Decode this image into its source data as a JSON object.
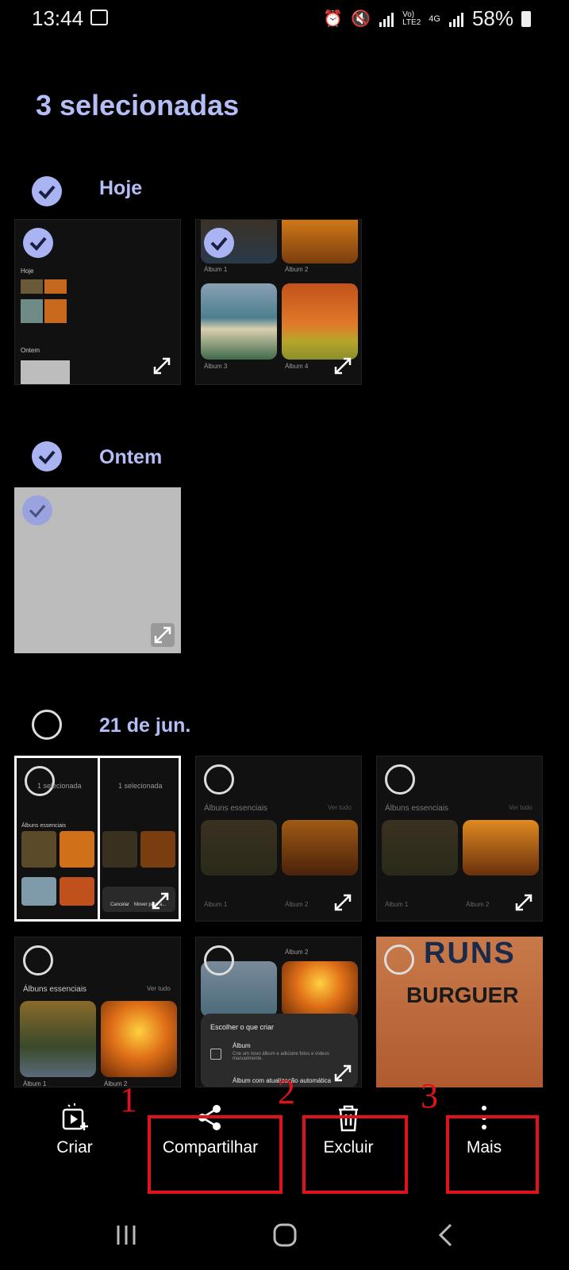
{
  "status": {
    "time": "13:44",
    "net1": "Vo)\nLTE2",
    "net2": "4G",
    "battery": "58%"
  },
  "title": "3 selecionadas",
  "sections": [
    {
      "label": "Hoje"
    },
    {
      "label": "Ontem"
    },
    {
      "label": "21 de jun."
    }
  ],
  "thumbs": {
    "t1": {
      "hoje": "Hoje",
      "ontem": "Ontem"
    },
    "t2": {
      "a1": "Álbum 1",
      "a2": "Álbum 2",
      "a3": "Álbum 3",
      "a4": "Álbum 4"
    },
    "t4": {
      "sel": "1 selecionada",
      "sel2": "1 selecionada",
      "albuns": "Álbuns essenciais",
      "cancel": "Cancelar",
      "move": "Mover para a..."
    },
    "t5": {
      "albuns": "Álbuns essenciais",
      "ver": "Ver tudo",
      "a1": "Álbum 1",
      "a2": "Álbum 2"
    },
    "t6": {
      "albuns": "Álbuns essenciais",
      "ver": "Ver tudo",
      "a1": "Álbum 1",
      "a2": "Álbum 2"
    },
    "t7": {
      "albuns": "Álbuns essenciais",
      "ver": "Ver tudo",
      "a1": "Álbum 1",
      "a2": "Álbum 2"
    },
    "t8": {
      "a2": "Álbum 2",
      "sheet_title": "Escolher o que criar",
      "opt1": "Álbum",
      "opt1_desc": "Crie um novo álbum e adicione fotos e vídeos manualmente.",
      "opt2": "Álbum com atualização automática"
    },
    "t9": {
      "sign1": "BURGUER"
    }
  },
  "bottom_bar": {
    "criar": "Criar",
    "compartilhar": "Compartilhar",
    "excluir": "Excluir",
    "mais": "Mais"
  },
  "annotations": {
    "n1": "1",
    "n2": "2",
    "n3": "3",
    "color": "#e0121b"
  },
  "accent": "#aab4f3"
}
